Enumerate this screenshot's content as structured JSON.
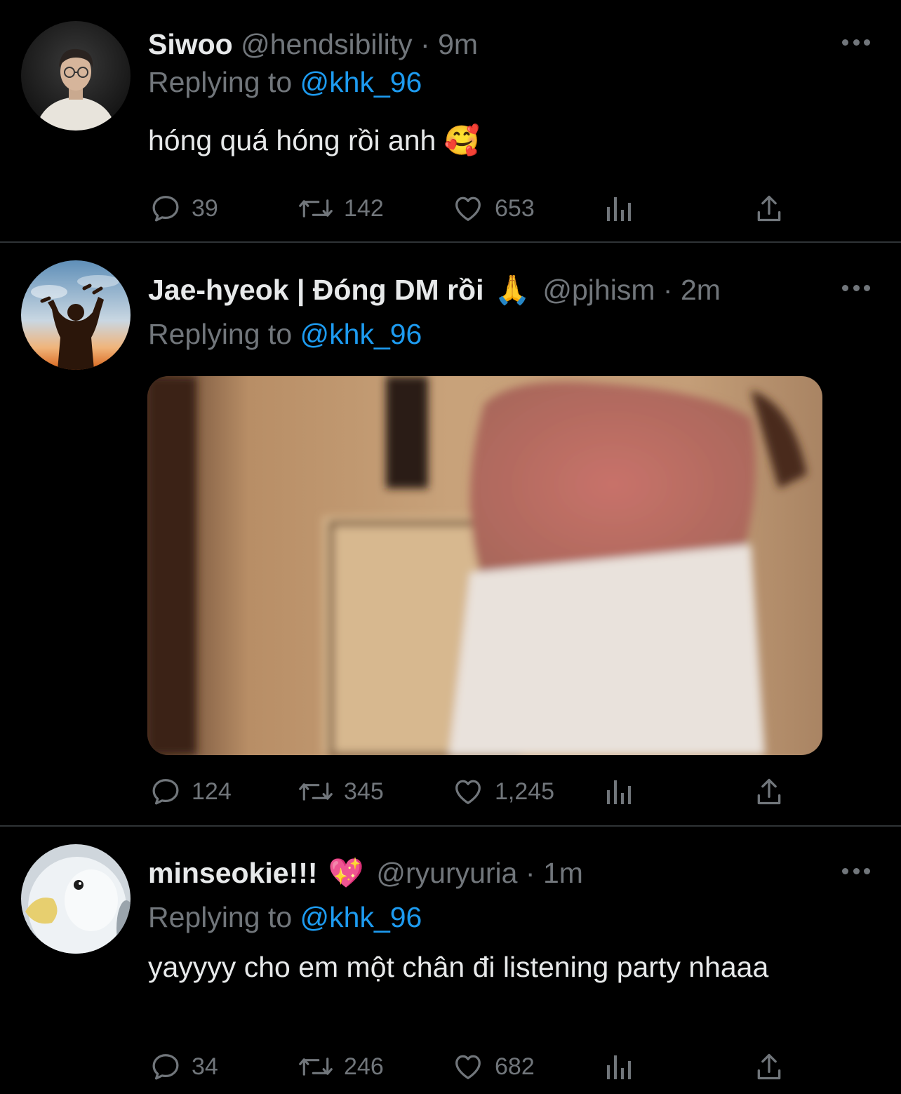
{
  "tweets": [
    {
      "name": "Siwoo",
      "handle": "@hendsibility",
      "separator": "·",
      "time": "9m",
      "replying_prefix": "Replying to",
      "replying_handle": "@khk_96",
      "text": "hóng quá hóng rồi anh",
      "text_emoji": "🥰",
      "counts": {
        "reply": "39",
        "retweet": "142",
        "like": "653"
      },
      "avatar_icon": "person-photo-avatar"
    },
    {
      "name": "Jae-hyeok | Đóng DM rồi",
      "name_emoji": "🙏",
      "handle": "@pjhism",
      "separator": "·",
      "time": "2m",
      "replying_prefix": "Replying to",
      "replying_handle": "@khk_96",
      "media": "blurred-gif-image",
      "counts": {
        "reply": "124",
        "retweet": "345",
        "like": "1,245"
      },
      "avatar_icon": "silhouette-broken-chains-avatar"
    },
    {
      "name": "minseokie!!!",
      "name_emoji": "💖",
      "handle": "@ryuryuria",
      "separator": "·",
      "time": "1m",
      "replying_prefix": "Replying to",
      "replying_handle": "@khk_96",
      "text": "yayyyy cho em một chân đi listening party nhaaa",
      "counts": {
        "reply": "34",
        "retweet": "246",
        "like": "682"
      },
      "avatar_icon": "penguin-plush-avatar"
    }
  ],
  "colors": {
    "background": "#000000",
    "text_primary": "#e7e9ea",
    "text_secondary": "#71767b",
    "accent": "#1d9bf0",
    "divider": "#2f3336"
  }
}
